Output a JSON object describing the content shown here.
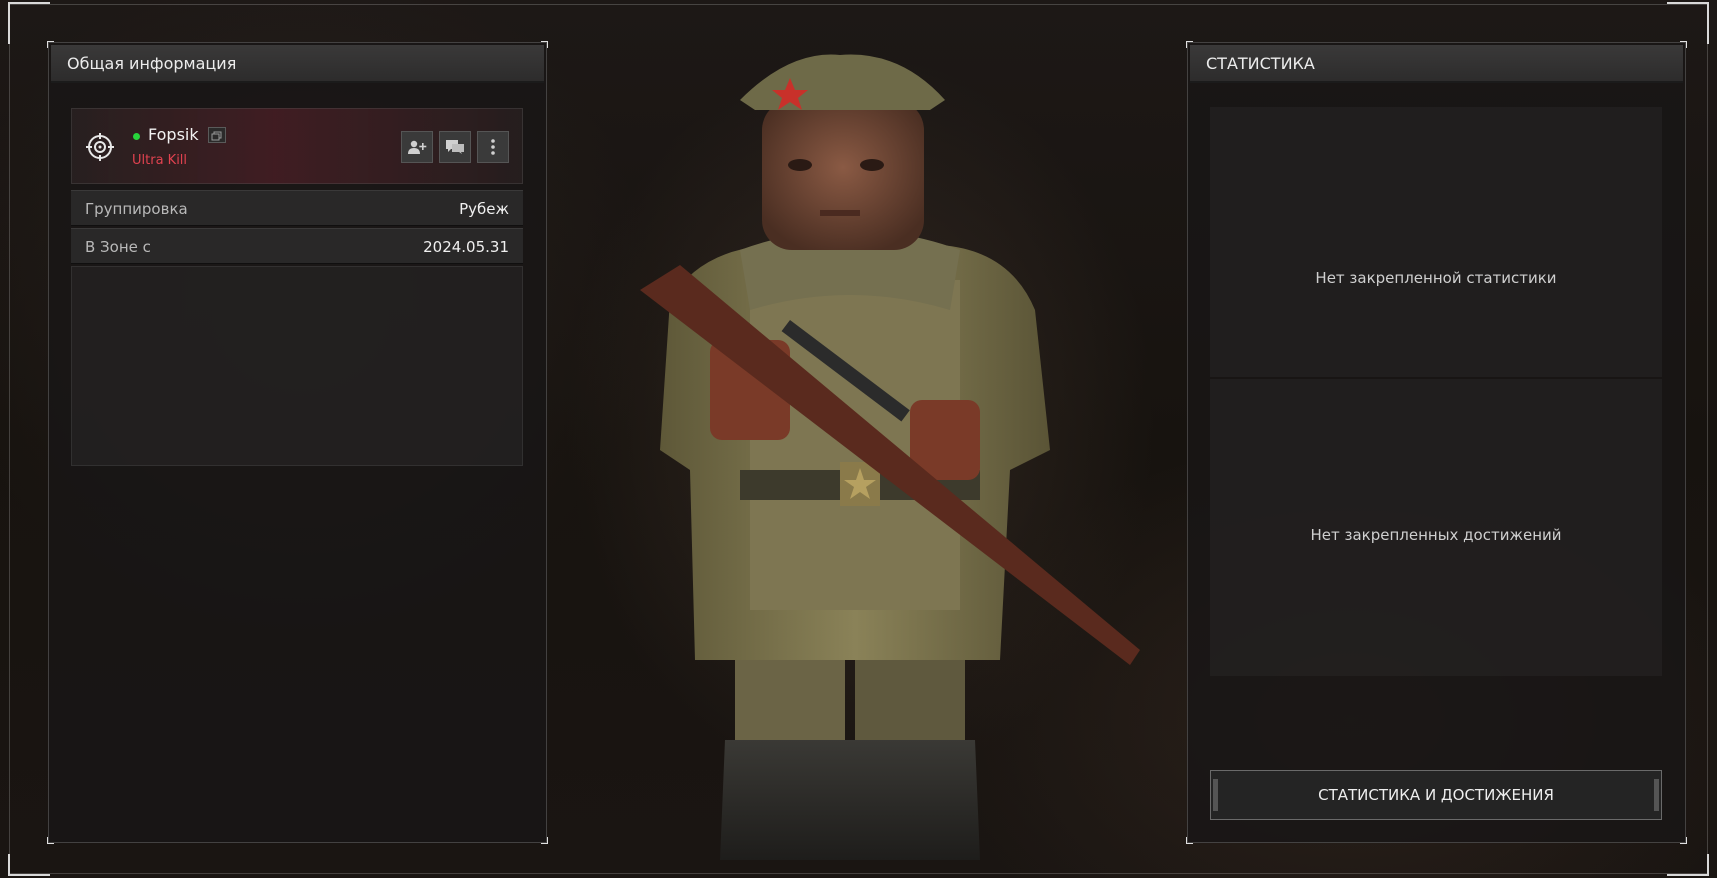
{
  "left_panel": {
    "title": "Общая информация",
    "player": {
      "name": "Fopsik",
      "status": "Ultra Kill",
      "online": true,
      "emblem_icon": "crosshair-emblem-icon",
      "actions": [
        {
          "icon": "add-friend-icon"
        },
        {
          "icon": "message-icon"
        },
        {
          "icon": "more-vertical-icon"
        }
      ]
    },
    "info": [
      {
        "label": "Группировка",
        "value": "Рубеж"
      },
      {
        "label": "В Зоне с",
        "value": "2024.05.31"
      }
    ]
  },
  "right_panel": {
    "title": "СТАТИСТИКА",
    "no_stats": "Нет закрепленной статистики",
    "no_achievements": "Нет закрепленных достижений",
    "button_label": "СТАТИСТИКА И ДОСТИЖЕНИЯ"
  },
  "colors": {
    "online": "#27d33b",
    "status": "#e0424f",
    "panel_header": "#3a3939"
  }
}
